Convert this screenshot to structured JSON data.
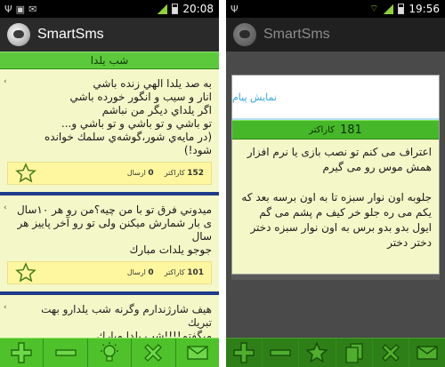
{
  "left": {
    "status": {
      "time": "20:08"
    },
    "app_title": "SmartSms",
    "section_title": "شب يلدا",
    "messages": [
      {
        "text": "به صد يلدا الهي زنده باشي\nانار و سيب و انگور خورده باشي\nاگر يلداي ديگر من نباشم\nتو باشي و تو باشي و تو باشي و...\n(در مايه‌ي شور،گوشه‌ي سلمك خوانده شود!)",
        "chars_value": "152",
        "chars_label": "كاراكتر",
        "sent_value": "0",
        "sent_label": "ارسال"
      },
      {
        "text": "ميدوني فرق تو با من چيه؟من رو هر ١٠سال\nى بار شمارش ميكنن ولى تو رو آخر پاييز هر\nسال\nجوجو يلدات مبارك",
        "chars_value": "101",
        "chars_label": "كاراكتر",
        "sent_value": "0",
        "sent_label": "ارسال"
      },
      {
        "text": "هيف شارژندارم وگرنه شب يلدارو بهت تبريك\nميگفتم!!!!شب يلدا مبارك"
      }
    ]
  },
  "right": {
    "status": {
      "time": "19:56"
    },
    "app_title": "SmartSms",
    "dialog": {
      "title": "نمايش پيام",
      "char_count": "181",
      "char_label": "كاراكتر",
      "body": "اعتراف مى كنم تو نصب بازى يا نرم افزار همش موس رو مى گيرم\n\nجلوبه اون نوار سبزه تا به اون برسه بعد كه يكم مى ره جلو خر كيف م پشم مى گم ايول بدو بدو برس به اون نوار سبزه دختر دختر دختر"
    }
  },
  "icons": {
    "add": "plus-icon",
    "remove": "minus-icon",
    "tip": "lightbulb-icon",
    "delete": "x-icon",
    "send": "envelope-icon",
    "favorite": "star-icon",
    "copy": "copy-icon"
  },
  "colors": {
    "green": "#4fc12a",
    "list_bg": "#f4f8c8",
    "meta_bg": "#fff79f",
    "divider": "#1e3a8a",
    "dialog_title": "#3aa6d8"
  }
}
